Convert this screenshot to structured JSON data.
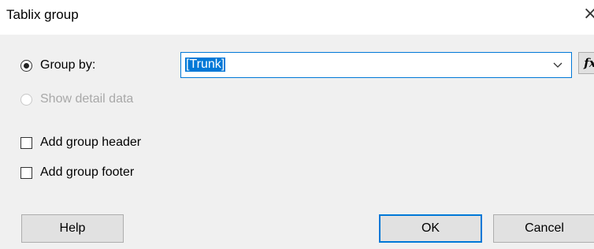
{
  "window": {
    "title": "Tablix group",
    "close_glyph": "✕"
  },
  "group_by": {
    "label": "Group by:",
    "selected": true,
    "expression_value": "[Trunk]",
    "fx_label": "fx"
  },
  "show_detail": {
    "label": "Show detail data",
    "selected": false,
    "enabled": false
  },
  "options": {
    "add_header_label": "Add group header",
    "add_header_checked": false,
    "add_footer_label": "Add group footer",
    "add_footer_checked": false
  },
  "buttons": {
    "help": "Help",
    "ok": "OK",
    "cancel": "Cancel"
  },
  "colors": {
    "accent": "#0078d7",
    "button_face": "#e1e1e1",
    "dialog_bg": "#f0f0f0"
  }
}
